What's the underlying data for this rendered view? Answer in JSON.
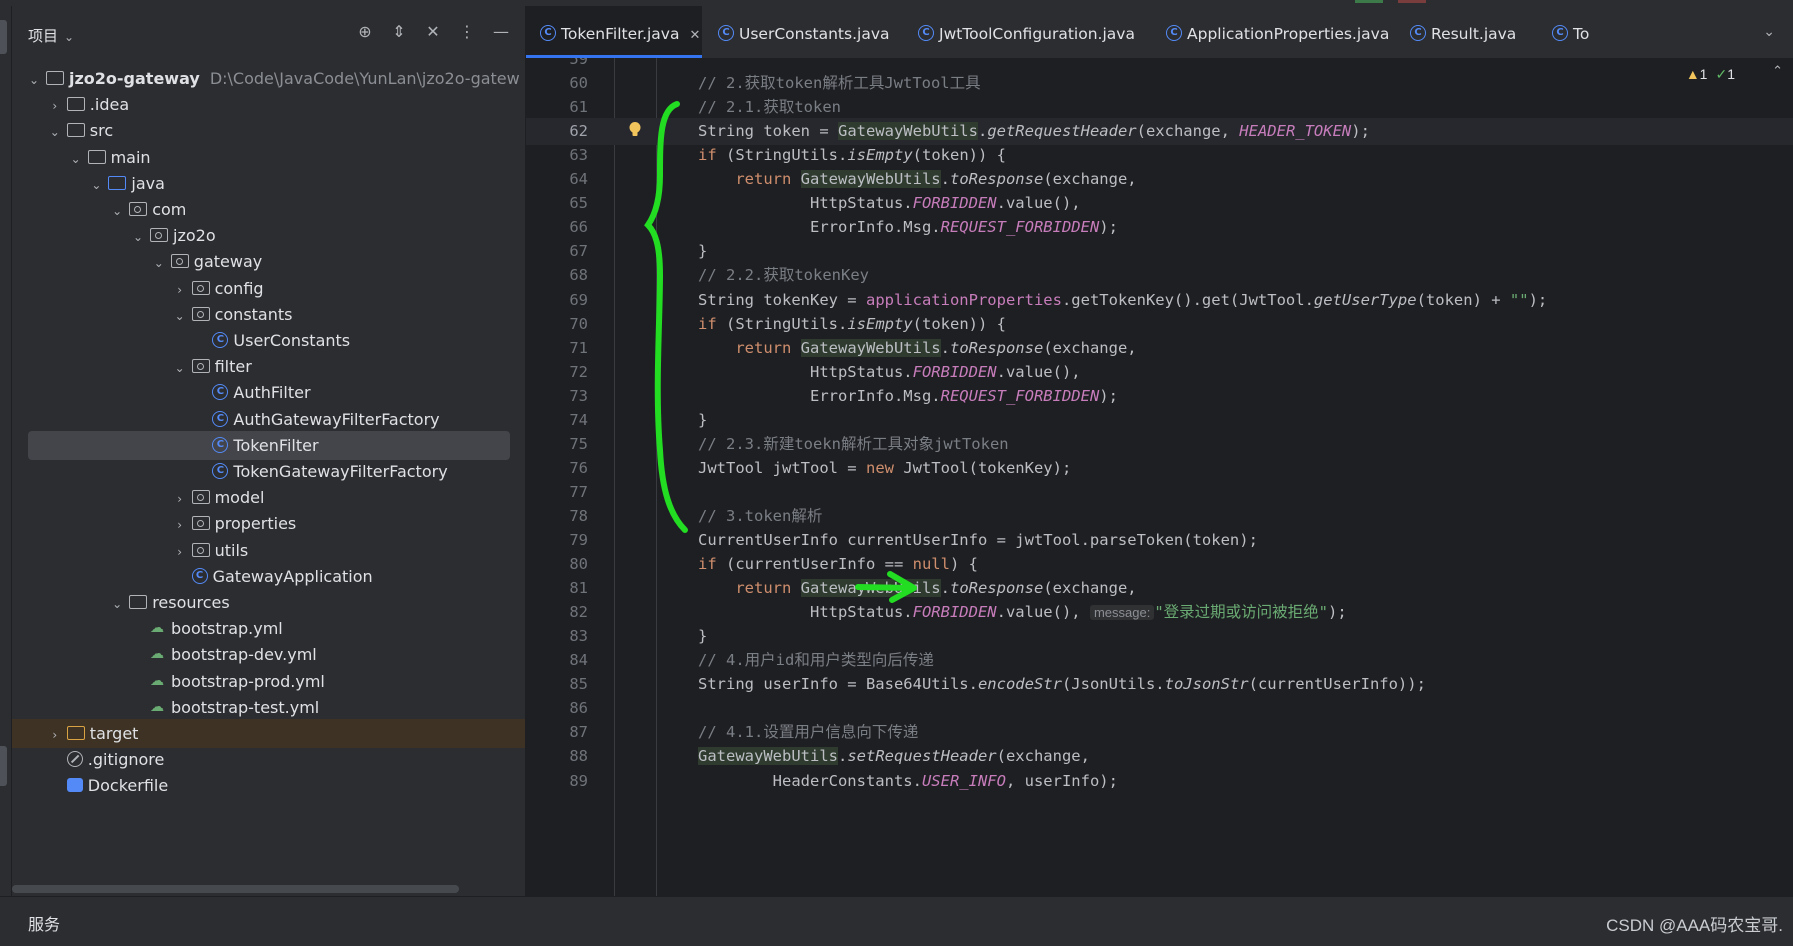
{
  "project_panel": {
    "title": "项目",
    "tree": [
      {
        "label": "jzo2o-gateway",
        "path": "D:\\Code\\JavaCode\\YunLan\\jzo2o-gatew",
        "type": "module",
        "expanded": true
      },
      {
        "label": ".idea",
        "type": "folder",
        "expanded": false
      },
      {
        "label": "src",
        "type": "folder",
        "expanded": true
      },
      {
        "label": "main",
        "type": "folder",
        "expanded": true
      },
      {
        "label": "java",
        "type": "source-folder",
        "expanded": true
      },
      {
        "label": "com",
        "type": "package",
        "expanded": true
      },
      {
        "label": "jzo2o",
        "type": "package",
        "expanded": true
      },
      {
        "label": "gateway",
        "type": "package",
        "expanded": true
      },
      {
        "label": "config",
        "type": "package",
        "expanded": false
      },
      {
        "label": "constants",
        "type": "package",
        "expanded": true
      },
      {
        "label": "UserConstants",
        "type": "class"
      },
      {
        "label": "filter",
        "type": "package",
        "expanded": true
      },
      {
        "label": "AuthFilter",
        "type": "class"
      },
      {
        "label": "AuthGatewayFilterFactory",
        "type": "class"
      },
      {
        "label": "TokenFilter",
        "type": "class",
        "selected": true
      },
      {
        "label": "TokenGatewayFilterFactory",
        "type": "class"
      },
      {
        "label": "model",
        "type": "package",
        "expanded": false
      },
      {
        "label": "properties",
        "type": "package",
        "expanded": false
      },
      {
        "label": "utils",
        "type": "package",
        "expanded": false
      },
      {
        "label": "GatewayApplication",
        "type": "app-class"
      },
      {
        "label": "resources",
        "type": "resources-folder",
        "expanded": true
      },
      {
        "label": "bootstrap.yml",
        "type": "yml"
      },
      {
        "label": "bootstrap-dev.yml",
        "type": "yml"
      },
      {
        "label": "bootstrap-prod.yml",
        "type": "yml"
      },
      {
        "label": "bootstrap-test.yml",
        "type": "yml"
      },
      {
        "label": "target",
        "type": "excluded-folder",
        "expanded": false
      },
      {
        "label": ".gitignore",
        "type": "ignore"
      },
      {
        "label": "Dockerfile",
        "type": "docker"
      }
    ]
  },
  "tabs": [
    {
      "label": "TokenFilter.java",
      "active": true,
      "closable": true
    },
    {
      "label": "UserConstants.java"
    },
    {
      "label": "JwtToolConfiguration.java"
    },
    {
      "label": "ApplicationProperties.java"
    },
    {
      "label": "Result.java"
    },
    {
      "label": "To"
    }
  ],
  "inspections": {
    "warnings": "1",
    "ok": "1"
  },
  "current_line": 62,
  "code_lines": [
    {
      "n": "59",
      "html": ""
    },
    {
      "n": "60",
      "html": "<span class='cm'>// 2.获取token解析工具JwtTool工具</span>"
    },
    {
      "n": "61",
      "html": "<span class='cm'>// 2.1.获取token</span>"
    },
    {
      "n": "62",
      "html": "<span class='pl'>String token = </span><span class='hl'>GatewayWebUtils</span><span class='pl'>.</span><span class='it pl'>getRequestHeader</span><span class='pl'>(exchange, </span><span class='fld'>HEADER_TOKEN</span><span class='pl'>);</span>"
    },
    {
      "n": "63",
      "html": "<span class='kw'>if</span><span class='pl'> (StringUtils.</span><span class='it pl'>isEmpty</span><span class='pl'>(token)) {</span>"
    },
    {
      "n": "64",
      "html": "<span class='kw'>    return </span><span class='hl'>GatewayWebUtils</span><span class='pl'>.</span><span class='it pl'>toResponse</span><span class='pl'>(exchange,</span>"
    },
    {
      "n": "65",
      "html": "<span class='pl'>            HttpStatus.</span><span class='fld'>FORBIDDEN</span><span class='pl'>.value(),</span>"
    },
    {
      "n": "66",
      "html": "<span class='pl'>            ErrorInfo.Msg.</span><span class='fld'>REQUEST_FORBIDDEN</span><span class='pl'>);</span>"
    },
    {
      "n": "67",
      "html": "<span class='pl'>}</span>"
    },
    {
      "n": "68",
      "html": "<span class='cm'>// 2.2.获取tokenKey</span>"
    },
    {
      "n": "69",
      "html": "<span class='pl'>String tokenKey = </span><span class='fld' style='font-style:normal'>applicationProperties</span><span class='pl'>.getTokenKey().get(JwtTool.</span><span class='it pl'>getUserType</span><span class='pl'>(token) + </span><span class='str'>\"\"</span><span class='pl'>);</span>"
    },
    {
      "n": "70",
      "html": "<span class='kw'>if</span><span class='pl'> (StringUtils.</span><span class='it pl'>isEmpty</span><span class='pl'>(token)) {</span>"
    },
    {
      "n": "71",
      "html": "<span class='kw'>    return </span><span class='hl'>GatewayWebUtils</span><span class='pl'>.</span><span class='it pl'>toResponse</span><span class='pl'>(exchange,</span>"
    },
    {
      "n": "72",
      "html": "<span class='pl'>            HttpStatus.</span><span class='fld'>FORBIDDEN</span><span class='pl'>.value(),</span>"
    },
    {
      "n": "73",
      "html": "<span class='pl'>            ErrorInfo.Msg.</span><span class='fld'>REQUEST_FORBIDDEN</span><span class='pl'>);</span>"
    },
    {
      "n": "74",
      "html": "<span class='pl'>}</span>"
    },
    {
      "n": "75",
      "html": "<span class='cm'>// 2.3.新建toekn解析工具对象jwtToken</span>"
    },
    {
      "n": "76",
      "html": "<span class='pl'>JwtTool jwtTool = </span><span class='kw'>new </span><span class='pl'>JwtTool(tokenKey);</span>"
    },
    {
      "n": "77",
      "html": ""
    },
    {
      "n": "78",
      "html": "<span class='cm'>// 3.token解析</span>"
    },
    {
      "n": "79",
      "html": "<span class='pl'>CurrentUserInfo currentUserInfo = jwtTool.parseToken(token);</span>"
    },
    {
      "n": "80",
      "html": "<span class='kw'>if</span><span class='pl'> (currentUserInfo == </span><span class='kw'>null</span><span class='pl'>) {</span>"
    },
    {
      "n": "81",
      "html": "<span class='kw'>    return </span><span class='hl'>GatewayWebUtils</span><span class='pl'>.</span><span class='it pl'>toResponse</span><span class='pl'>(exchange,</span>"
    },
    {
      "n": "82",
      "html": "<span class='pl'>            HttpStatus.</span><span class='fld'>FORBIDDEN</span><span class='pl'>.value(), </span><span class='hint'>message:</span><span class='str'>\"登录过期或访问被拒绝\"</span><span class='pl'>);</span>"
    },
    {
      "n": "83",
      "html": "<span class='pl'>}</span>"
    },
    {
      "n": "84",
      "html": "<span class='cm'>// 4.用户id和用户类型向后传递</span>"
    },
    {
      "n": "85",
      "html": "<span class='pl'>String userInfo = Base64Utils.</span><span class='it pl'>encodeStr</span><span class='pl'>(JsonUtils.</span><span class='it pl'>toJsonStr</span><span class='pl'>(currentUserInfo));</span>"
    },
    {
      "n": "86",
      "html": ""
    },
    {
      "n": "87",
      "html": "<span class='cm'>// 4.1.设置用户信息向下传递</span>"
    },
    {
      "n": "88",
      "html": "<span class='hl'>GatewayWebUtils</span><span class='pl'>.</span><span class='it pl'>setRequestHeader</span><span class='pl'>(exchange,</span>"
    },
    {
      "n": "89",
      "html": "<span class='pl'>        HeaderConstants.</span><span class='fld'>USER_INFO</span><span class='pl'>, userInfo);</span>"
    }
  ],
  "bottom_bar": {
    "label": "服务"
  },
  "watermark": "CSDN @AAA码农宝哥.",
  "annotation_color": "#22dd22"
}
